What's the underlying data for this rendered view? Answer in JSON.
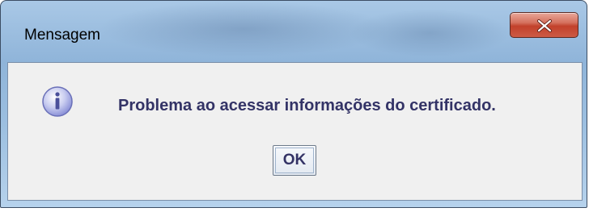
{
  "window": {
    "title": "Mensagem",
    "close_icon": "close-icon"
  },
  "dialog": {
    "icon": "information-icon",
    "message": "Problema ao acessar informações do certificado.",
    "ok_label": "OK"
  },
  "colors": {
    "message_text": "#333366",
    "close_button": "#c2412b",
    "titlebar": "#9cbfe0",
    "content_bg": "#f0f0f0"
  }
}
